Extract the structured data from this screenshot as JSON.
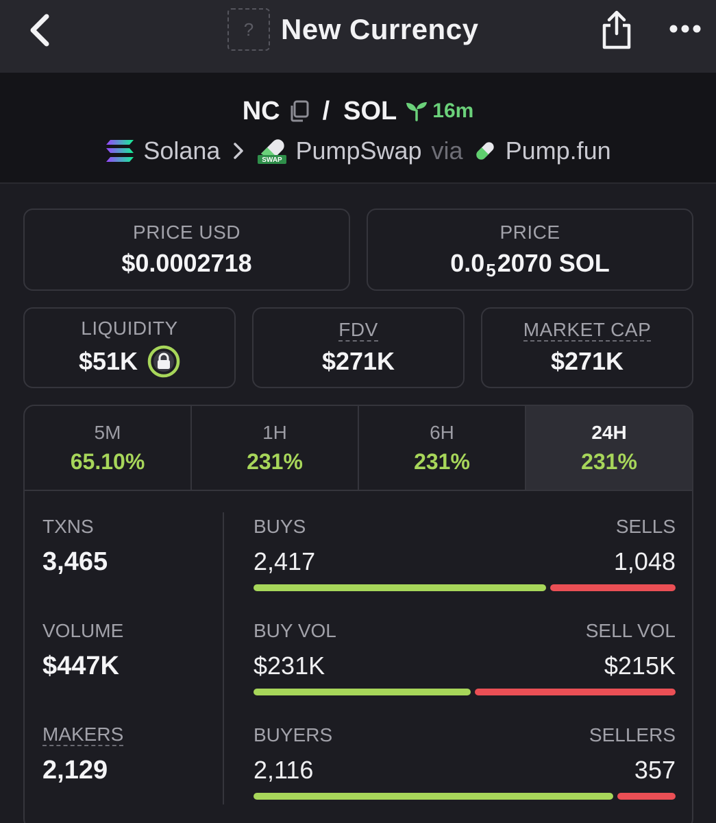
{
  "nav": {
    "title": "New Currency",
    "token_placeholder": "?"
  },
  "pair": {
    "base": "NC",
    "quote": "SOL",
    "age": "16m",
    "chain": "Solana",
    "dex": "PumpSwap",
    "via_label": "via",
    "launchpad": "Pump.fun",
    "dex_badge": "SWAP"
  },
  "cards": {
    "price_usd": {
      "label": "PRICE USD",
      "value": "$0.0002718"
    },
    "price_native": {
      "label": "PRICE",
      "prefix": "0.0",
      "zeros": "5",
      "digits": "2070",
      "unit": "SOL"
    },
    "liquidity": {
      "label": "LIQUIDITY",
      "value": "$51K"
    },
    "fdv": {
      "label": "FDV",
      "value": "$271K"
    },
    "market_cap": {
      "label": "MARKET CAP",
      "value": "$271K"
    }
  },
  "tabs": [
    {
      "label": "5M",
      "change": "65.10%"
    },
    {
      "label": "1H",
      "change": "231%"
    },
    {
      "label": "6H",
      "change": "231%"
    },
    {
      "label": "24H",
      "change": "231%"
    }
  ],
  "active_tab": "24H",
  "stats": {
    "txns": {
      "label": "TXNS",
      "value": "3,465"
    },
    "volume": {
      "label": "VOLUME",
      "value": "$447K"
    },
    "makers": {
      "label": "MAKERS",
      "value": "2,129"
    }
  },
  "ratios": [
    {
      "left_label": "BUYS",
      "right_label": "SELLS",
      "left_value": "2,417",
      "right_value": "1,048",
      "buy_fraction": 0.7
    },
    {
      "left_label": "BUY VOL",
      "right_label": "SELL VOL",
      "left_value": "$231K",
      "right_value": "$215K",
      "buy_fraction": 0.52
    },
    {
      "left_label": "BUYERS",
      "right_label": "SELLERS",
      "left_value": "2,116",
      "right_value": "357",
      "buy_fraction": 0.86
    }
  ],
  "colors": {
    "positive": "#a7d65a",
    "negative": "#ea4f55",
    "age_green": "#6bd17a"
  }
}
